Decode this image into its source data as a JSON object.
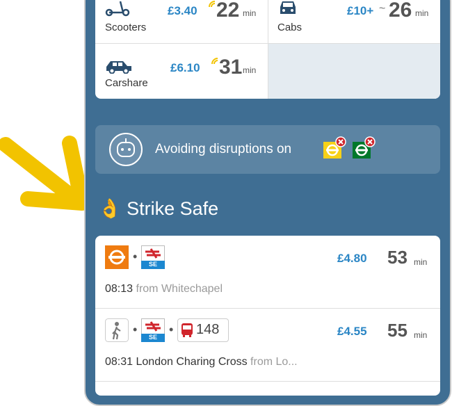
{
  "transport_options": [
    {
      "label": "Scooters",
      "price": "£3.40",
      "minutes": "22",
      "unit": "min",
      "icon": "scooter-icon",
      "live": true
    },
    {
      "label": "Cabs",
      "price": "£10+",
      "approx": "~",
      "minutes": "26",
      "unit": "min",
      "icon": "cab-icon",
      "live": false
    },
    {
      "label": "Carshare",
      "price": "£6.10",
      "minutes": "31",
      "unit": "min",
      "icon": "car-icon",
      "live": true
    }
  ],
  "disruption_banner": {
    "text": "Avoiding disruptions on",
    "lines": [
      {
        "name": "circle-line",
        "color": "#f7d117"
      },
      {
        "name": "district-line",
        "color": "#00782a"
      }
    ]
  },
  "section_heading": {
    "emoji": "👌",
    "title": "Strike Safe"
  },
  "routes": [
    {
      "price": "£4.80",
      "minutes": "53",
      "unit": "min",
      "time": "08:13",
      "detail": "from Whitechapel",
      "detail_muted": "",
      "modes": [
        "overground-icon",
        "national-rail-se-icon"
      ]
    },
    {
      "price": "£4.55",
      "minutes": "55",
      "unit": "min",
      "time": "08:31",
      "detail": "London Charing Cross",
      "detail_muted": "from Lo...",
      "modes": [
        "walk-icon",
        "national-rail-se-icon",
        "bus-icon"
      ],
      "bus_number": "148"
    }
  ],
  "rail_badge_label": "SE",
  "colors": {
    "background": "#3f6e93",
    "accent": "#2b86c5",
    "overground": "#ef7b10",
    "arrow": "#f2c300"
  }
}
